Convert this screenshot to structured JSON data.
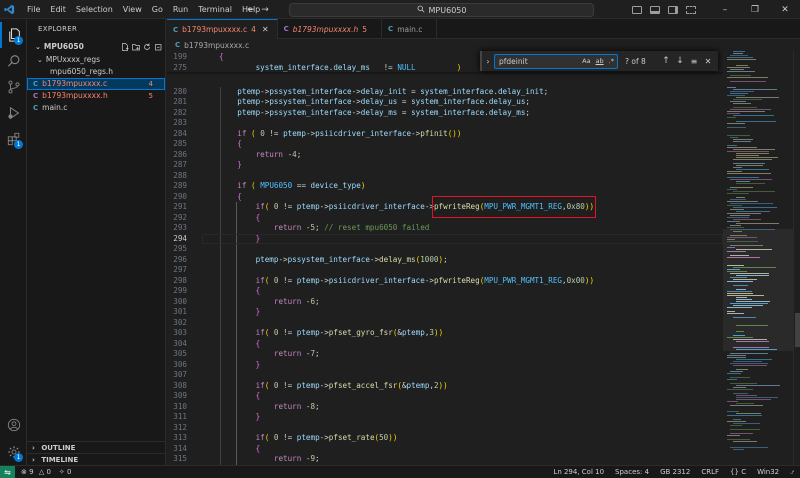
{
  "window": {
    "title": "MPU6050",
    "menu": [
      "File",
      "Edit",
      "Selection",
      "View",
      "Go",
      "Run",
      "Terminal",
      "Help"
    ]
  },
  "sidebar": {
    "header": "EXPLORER",
    "project": "MPU6050",
    "tree": [
      {
        "label": "MPUxxxx_regs",
        "kind": "folder",
        "modified": false,
        "count": ""
      },
      {
        "label": "mpu6050_regs.h",
        "kind": "file",
        "modified": false,
        "count": ""
      },
      {
        "label": "b1793mpuxxxx.c",
        "kind": "file",
        "modified": true,
        "count": "4"
      },
      {
        "label": "b1793mpuxxxx.h",
        "kind": "file",
        "modified": true,
        "count": "5"
      },
      {
        "label": "main.c",
        "kind": "file",
        "modified": false,
        "count": ""
      }
    ],
    "outline": "OUTLINE",
    "timeline": "TIMELINE"
  },
  "tabs": [
    {
      "label": "b1793mpuxxxx.c",
      "badge": "4",
      "active": true,
      "italic": false
    },
    {
      "label": "b1793mpuxxxx.h",
      "badge": "5",
      "active": false,
      "italic": true
    },
    {
      "label": "main.c",
      "badge": "",
      "active": false,
      "italic": false
    }
  ],
  "breadcrumb": "b1793mpuxxxx.c",
  "find": {
    "query": "pfdeinit",
    "options": [
      "Aa",
      "ab",
      ".*"
    ],
    "result": "? of 8"
  },
  "editor": {
    "current_line": "294",
    "lines": [
      {
        "n": "199",
        "code": "{"
      },
      {
        "n": "275",
        "code": "        system_interface.delay_ms   != NULL         )"
      },
      {
        "n": "280",
        "code": "    ptemp->pssystem_interface->delay_init = system_interface.delay_init;"
      },
      {
        "n": "281",
        "code": "    ptemp->pssystem_interface->delay_us = system_interface.delay_us;"
      },
      {
        "n": "282",
        "code": "    ptemp->pssystem_interface->delay_ms = system_interface.delay_ms;"
      },
      {
        "n": "283",
        "code": ""
      },
      {
        "n": "284",
        "code": "    if ( 0 != ptemp->psiicdriver_interface->pfinit())"
      },
      {
        "n": "285",
        "code": "    {"
      },
      {
        "n": "286",
        "code": "        return -4;"
      },
      {
        "n": "287",
        "code": "    }"
      },
      {
        "n": "288",
        "code": ""
      },
      {
        "n": "289",
        "code": "    if ( MPU6050 == device_type)"
      },
      {
        "n": "290",
        "code": "    {"
      },
      {
        "n": "291",
        "code": "        if( 0 != ptemp->psiicdriver_interface->pfwriteReg(MPU_PWR_MGMT1_REG,0x80))"
      },
      {
        "n": "292",
        "code": "        {"
      },
      {
        "n": "293",
        "code": "            return -5; // reset mpu6050 failed"
      },
      {
        "n": "294",
        "code": "        }"
      },
      {
        "n": "295",
        "code": ""
      },
      {
        "n": "296",
        "code": "        ptemp->pssystem_interface->delay_ms(1000);"
      },
      {
        "n": "297",
        "code": ""
      },
      {
        "n": "298",
        "code": "        if( 0 != ptemp->psiicdriver_interface->pfwriteReg(MPU_PWR_MGMT1_REG,0x00))"
      },
      {
        "n": "299",
        "code": "        {"
      },
      {
        "n": "300",
        "code": "            return -6;"
      },
      {
        "n": "301",
        "code": "        }"
      },
      {
        "n": "302",
        "code": ""
      },
      {
        "n": "303",
        "code": "        if( 0 != ptemp->pfset_gyro_fsr(&ptemp,3))"
      },
      {
        "n": "304",
        "code": "        {"
      },
      {
        "n": "305",
        "code": "            return -7;"
      },
      {
        "n": "306",
        "code": "        }"
      },
      {
        "n": "307",
        "code": ""
      },
      {
        "n": "308",
        "code": "        if( 0 != ptemp->pfset_accel_fsr(&ptemp,2))"
      },
      {
        "n": "309",
        "code": "        {"
      },
      {
        "n": "310",
        "code": "            return -8;"
      },
      {
        "n": "311",
        "code": "        }"
      },
      {
        "n": "312",
        "code": ""
      },
      {
        "n": "313",
        "code": "        if( 0 != ptemp->pfset_rate(50))"
      },
      {
        "n": "314",
        "code": "        {"
      },
      {
        "n": "315",
        "code": "            return -9;"
      }
    ]
  },
  "statusbar": {
    "errors": "9",
    "warnings": "0",
    "ports": "0",
    "position": "Ln 294, Col 10",
    "indent": "Spaces: 4",
    "encoding": "GB 2312",
    "eol": "CRLF",
    "language": "C",
    "platform": "Win32"
  },
  "colors": {
    "accent": "#0078d4",
    "keyword": "#569cd6",
    "control": "#c586c0",
    "function": "#dcdcaa",
    "variable": "#9cdcfe",
    "number": "#b5cea8",
    "comment": "#6a9955",
    "constant": "#4fc1ff",
    "modified": "#f48771",
    "highlight_box": "#e81123"
  }
}
